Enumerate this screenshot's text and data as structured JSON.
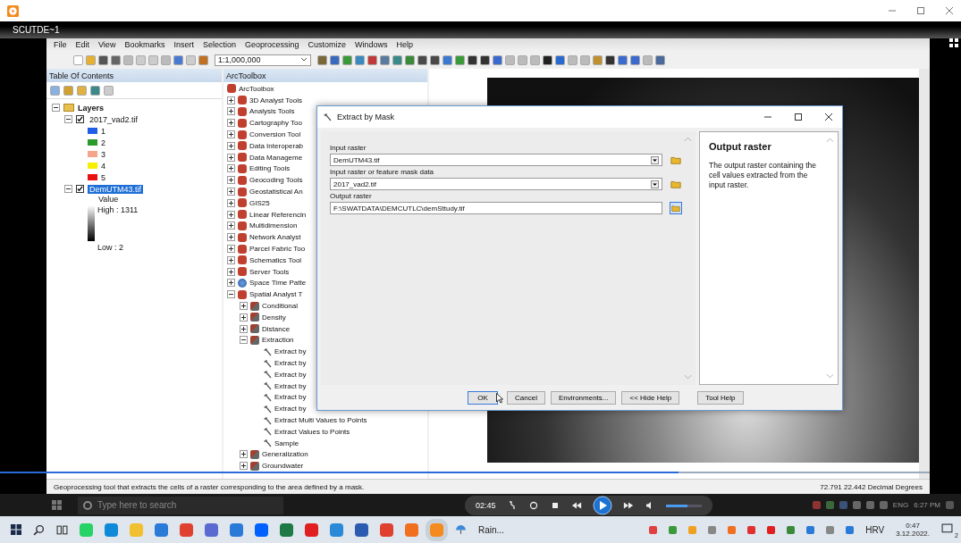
{
  "player": {
    "video_title": "SCUTDE~1"
  },
  "menu": [
    "File",
    "Edit",
    "View",
    "Bookmarks",
    "Insert",
    "Selection",
    "Geoprocessing",
    "Customize",
    "Windows",
    "Help"
  ],
  "toolbar": {
    "scale": "1:1,000,000"
  },
  "toc": {
    "title": "Table Of Contents",
    "root": "Layers",
    "layers": [
      {
        "name": "2017_vad2.tif",
        "checked": true,
        "selected": false,
        "legend": [
          {
            "label": "1",
            "color": "#1f5fe8"
          },
          {
            "label": "2",
            "color": "#2a9a2a"
          },
          {
            "label": "3",
            "color": "#f4a58a"
          },
          {
            "label": "4",
            "color": "#f5f000"
          },
          {
            "label": "5",
            "color": "#e81010"
          }
        ]
      },
      {
        "name": "DemUTM43.tif",
        "checked": true,
        "selected": true,
        "ramp": {
          "title": "Value",
          "high": "High : 1311",
          "low": "Low : 2"
        }
      }
    ]
  },
  "toolbox": {
    "title": "ArcToolbox",
    "root": "ArcToolbox",
    "items": [
      {
        "kind": "toolbox",
        "label": "3D Analyst Tools",
        "expanded": false
      },
      {
        "kind": "toolbox",
        "label": "Analysis Tools",
        "expanded": false
      },
      {
        "kind": "toolbox",
        "label": "Cartography Too",
        "expanded": false
      },
      {
        "kind": "toolbox",
        "label": "Conversion Tool",
        "expanded": false
      },
      {
        "kind": "toolbox",
        "label": "Data Interoperab",
        "expanded": false
      },
      {
        "kind": "toolbox",
        "label": "Data Manageme",
        "expanded": false
      },
      {
        "kind": "toolbox",
        "label": "Editing Tools",
        "expanded": false
      },
      {
        "kind": "toolbox",
        "label": "Geocoding Tools",
        "expanded": false
      },
      {
        "kind": "toolbox",
        "label": "Geostatistical An",
        "expanded": false
      },
      {
        "kind": "toolbox",
        "label": "GIS25",
        "expanded": false
      },
      {
        "kind": "toolbox",
        "label": "Linear Referencin",
        "expanded": false
      },
      {
        "kind": "toolbox",
        "label": "Multidimension",
        "expanded": false
      },
      {
        "kind": "toolbox",
        "label": "Network Analyst",
        "expanded": false
      },
      {
        "kind": "toolbox",
        "label": "Parcel Fabric Too",
        "expanded": false
      },
      {
        "kind": "toolbox",
        "label": "Schematics Tool",
        "expanded": false
      },
      {
        "kind": "toolbox",
        "label": "Server Tools",
        "expanded": false
      },
      {
        "kind": "globe",
        "label": "Space Time Patte",
        "expanded": false
      },
      {
        "kind": "toolbox",
        "label": "Spatial Analyst T",
        "expanded": true,
        "children": [
          {
            "kind": "toolset",
            "label": "Conditional",
            "expanded": false
          },
          {
            "kind": "toolset",
            "label": "Density",
            "expanded": false
          },
          {
            "kind": "toolset",
            "label": "Distance",
            "expanded": false
          },
          {
            "kind": "toolset",
            "label": "Extraction",
            "expanded": true,
            "children": [
              {
                "kind": "tool",
                "label": "Extract by"
              },
              {
                "kind": "tool",
                "label": "Extract by"
              },
              {
                "kind": "tool",
                "label": "Extract by"
              },
              {
                "kind": "tool",
                "label": "Extract by"
              },
              {
                "kind": "tool",
                "label": "Extract by"
              },
              {
                "kind": "tool",
                "label": "Extract by"
              },
              {
                "kind": "tool",
                "label": "Extract Multi Values to Points"
              },
              {
                "kind": "tool",
                "label": "Extract Values to Points"
              },
              {
                "kind": "tool",
                "label": "Sample"
              }
            ]
          },
          {
            "kind": "toolset",
            "label": "Generalization",
            "expanded": false
          },
          {
            "kind": "toolset",
            "label": "Groundwater",
            "expanded": false
          }
        ]
      }
    ]
  },
  "dialog": {
    "title": "Extract by Mask",
    "params": [
      {
        "label": "Input raster",
        "value": "DemUTM43.tif",
        "kind": "dropdown"
      },
      {
        "label": "Input raster or feature mask data",
        "value": "2017_vad2.tif",
        "kind": "dropdown"
      },
      {
        "label": "Output raster",
        "value": "F:\\SWATDATA\\DEMCUTLC\\demSttudy.tif",
        "kind": "text"
      }
    ],
    "help_title": "Output raster",
    "help_text": "The output raster containing the cell values extracted from the input raster.",
    "buttons": [
      "OK",
      "Cancel",
      "Environments...",
      "<< Hide Help",
      "Tool Help"
    ]
  },
  "status_bar": {
    "message": "Geoprocessing tool that extracts the cells of a raster corresponding to the area defined by a mask.",
    "coordinates": "72.791  22.442 Decimal Degrees"
  },
  "recorded_taskbar": {
    "search_placeholder": "Type here to search",
    "language": "ENG",
    "time": "6:27 PM"
  },
  "player_controls": {
    "time": "02:45",
    "seek": {
      "level": 0.73
    },
    "volume": {
      "level": 0.6
    }
  },
  "taskbar": {
    "weather": "Rain...",
    "language": "HRV",
    "time": "0:47",
    "date": "3.12.2022.",
    "notifications": "2"
  }
}
